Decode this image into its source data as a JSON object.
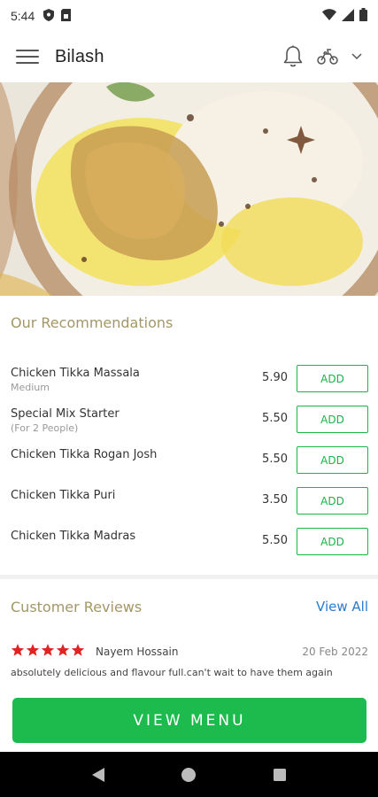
{
  "status_bar": {
    "time": "5:44",
    "left_icons": [
      "shield-icon",
      "sim-card-icon"
    ],
    "right_icons": [
      "wifi-icon",
      "signal-icon",
      "battery-icon"
    ]
  },
  "app_bar": {
    "title": "Bilash",
    "icons": [
      "menu-icon",
      "bell-icon",
      "scooter-icon",
      "chevron-down-icon"
    ]
  },
  "recommendations": {
    "title": "Our Recommendations",
    "add_label": "ADD",
    "items": [
      {
        "name": "Chicken Tikka Massala",
        "subtitle": "Medium",
        "price": "5.90"
      },
      {
        "name": "Special Mix Starter",
        "subtitle": "(For 2 People)",
        "price": "5.50"
      },
      {
        "name": "Chicken Tikka Rogan Josh",
        "subtitle": "",
        "price": "5.50"
      },
      {
        "name": "Chicken Tikka Puri",
        "subtitle": "",
        "price": "3.50"
      },
      {
        "name": "Chicken Tikka Madras",
        "subtitle": "",
        "price": "5.50"
      }
    ]
  },
  "reviews": {
    "title": "Customer Reviews",
    "view_all": "View All",
    "items": [
      {
        "rating": 5,
        "reviewer": "Nayem Hossain",
        "date": "20 Feb 2022",
        "text": "absolutely delicious and flavour full.can't wait to have them again"
      }
    ]
  },
  "cta": {
    "label": "VIEW MENU"
  },
  "system_nav": [
    "back-icon",
    "home-icon",
    "recents-icon"
  ],
  "colors": {
    "accent_green": "#1dbb4e",
    "section_title": "#a39766",
    "link_blue": "#2a7bd0",
    "star_red": "#e02424"
  }
}
